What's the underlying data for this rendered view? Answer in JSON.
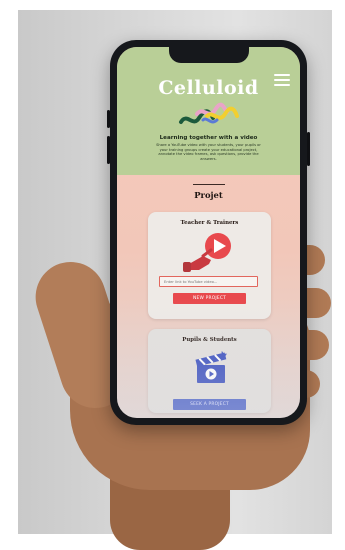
{
  "app": {
    "brand": "Celluloid",
    "tagline": "Learning together with a video",
    "description": "Share a YouTube video with your students, your pupils or your training groups create your educational project, annotate the video frames, ask questions, provide the answers.",
    "menu_icon": "hamburger-menu-icon",
    "accent_green": "#b9cf97",
    "accent_red": "#e8494d",
    "accent_blue": "#4a61c9"
  },
  "projects": {
    "title": "Projet",
    "teachers": {
      "title": "Teacher & Trainers",
      "illustration_icon": "hand-play-video-icon",
      "input_placeholder": "Enter link to YouTube video...",
      "button_label": "NEW PROJECT"
    },
    "students": {
      "title": "Pupils & Students",
      "illustration_icon": "clapperboard-icon",
      "button_label": "SEEK A PROJECT"
    }
  }
}
